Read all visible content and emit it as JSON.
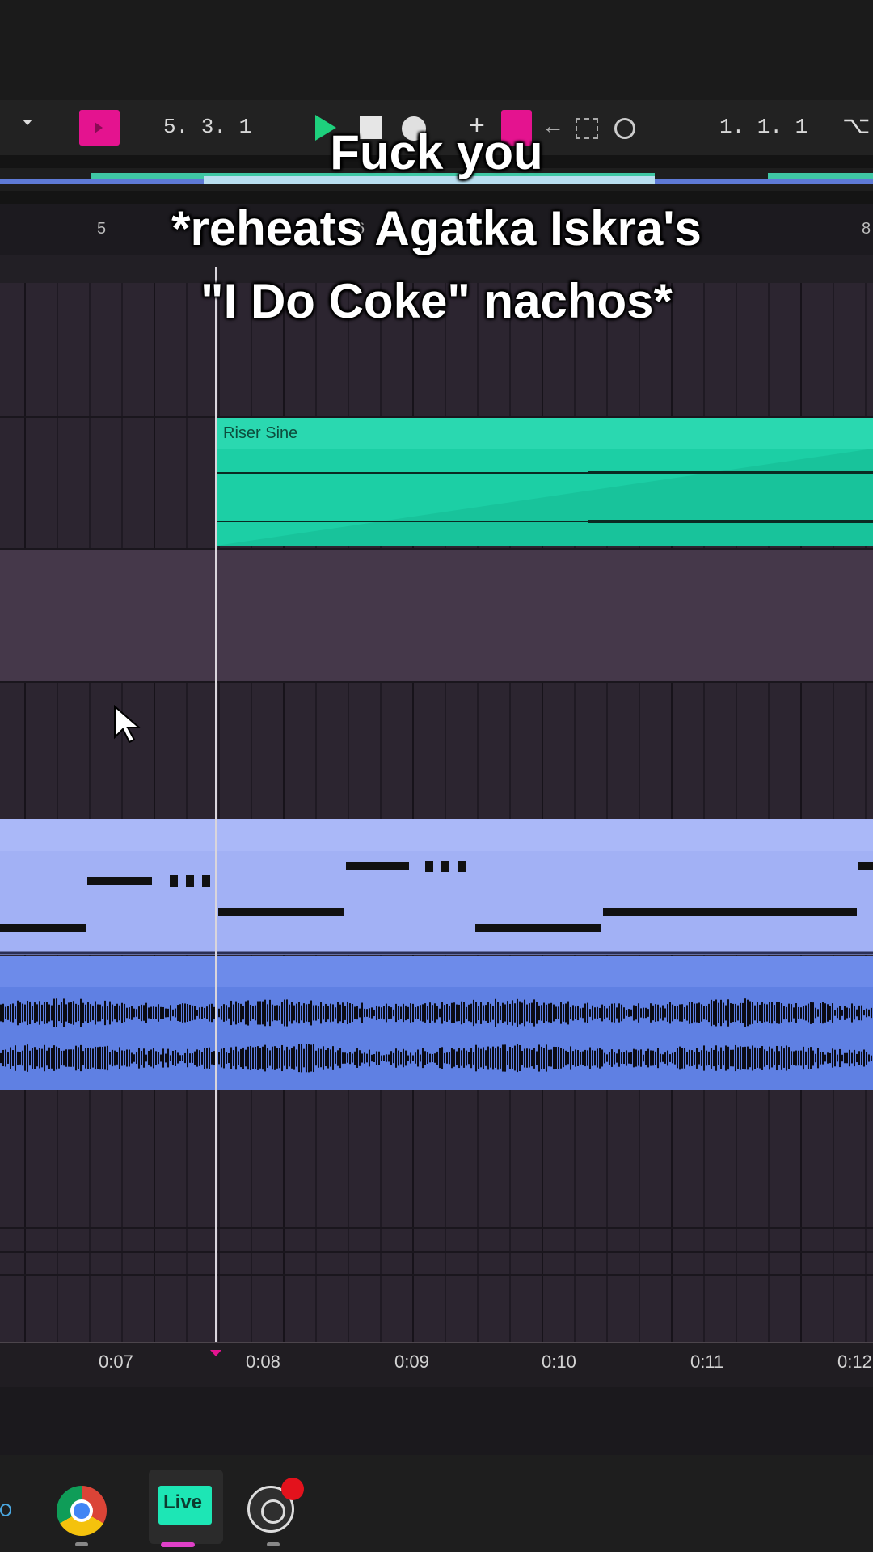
{
  "transport": {
    "arrangement_position": "5. 3. 1",
    "loop_position": "1. 1. 1"
  },
  "ruler": {
    "bar_left": "5",
    "bar_mid": "6",
    "bar_right": "8"
  },
  "arrangement": {
    "clips": [
      {
        "name": "Riser Sine",
        "color": "#1ccfa5"
      }
    ]
  },
  "timeline": {
    "labels": [
      "0:07",
      "0:08",
      "0:09",
      "0:10",
      "0:11",
      "0:12"
    ]
  },
  "caption": {
    "line1": "Fuck you",
    "line2": "*reheats Agatka Iskra's",
    "line3": "\"I Do Coke\" nachos*"
  },
  "taskbar": {
    "apps": [
      {
        "name": "chrome-icon"
      },
      {
        "name": "ableton-live-icon",
        "label": "Live"
      },
      {
        "name": "obs-icon"
      }
    ]
  },
  "colors": {
    "accent_pink": "#e4138f",
    "riser": "#1ccfa5",
    "midi": "#a2b1f5",
    "audio": "#5f80e3"
  }
}
